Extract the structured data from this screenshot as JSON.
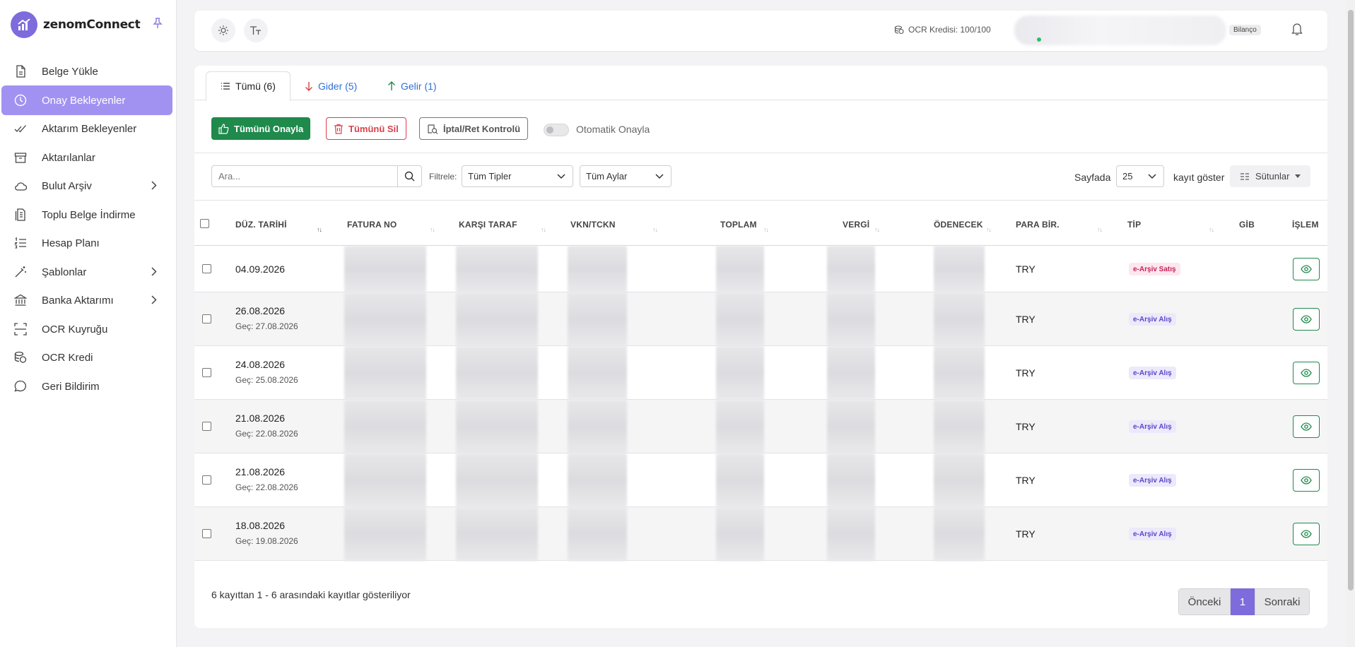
{
  "brand": {
    "name": "zenomConnect",
    "logo_color": "#7e6bdc"
  },
  "sidebar": {
    "items": [
      {
        "label": "Belge Yükle",
        "icon": "document-upload-icon",
        "active": false,
        "chevron": false
      },
      {
        "label": "Onay Bekleyenler",
        "icon": "clock-icon",
        "active": true,
        "chevron": false
      },
      {
        "label": "Aktarım Bekleyenler",
        "icon": "double-check-icon",
        "active": false,
        "chevron": false
      },
      {
        "label": "Aktarılanlar",
        "icon": "archive-box-icon",
        "active": false,
        "chevron": false
      },
      {
        "label": "Bulut Arşiv",
        "icon": "cloud-icon",
        "active": false,
        "chevron": true
      },
      {
        "label": "Toplu Belge İndirme",
        "icon": "files-icon",
        "active": false,
        "chevron": false
      },
      {
        "label": "Hesap Planı",
        "icon": "list-numbered-icon",
        "active": false,
        "chevron": false
      },
      {
        "label": "Şablonlar",
        "icon": "magic-wand-icon",
        "active": false,
        "chevron": true
      },
      {
        "label": "Banka Aktarımı",
        "icon": "bank-icon",
        "active": false,
        "chevron": true
      },
      {
        "label": "OCR Kuyruğu",
        "icon": "scan-icon",
        "active": false,
        "chevron": false
      },
      {
        "label": "OCR Kredi",
        "icon": "coins-icon",
        "active": false,
        "chevron": false
      },
      {
        "label": "Geri Bildirim",
        "icon": "chat-bubble-icon",
        "active": false,
        "chevron": false
      }
    ]
  },
  "topbar": {
    "ocr_credit": "OCR Kredisi: 100/100",
    "company_badge": "Bilanço"
  },
  "tabs": [
    {
      "label": "Tümü (6)",
      "active": true
    },
    {
      "label": "Gider (5)",
      "active": false
    },
    {
      "label": "Gelir (1)",
      "active": false
    }
  ],
  "actions": {
    "approve_all": "Tümünü Onayla",
    "delete_all": "Tümünü Sil",
    "cancel_check": "İptal/Ret Kontrolü",
    "auto_approve": "Otomatik Onayla",
    "auto_approve_on": false
  },
  "filters": {
    "search_placeholder": "Ara...",
    "filter_label": "Filtrele:",
    "type_select": "Tüm Tipler",
    "month_select": "Tüm Aylar",
    "per_page_prefix": "Sayfada",
    "per_page_value": "25",
    "per_page_suffix": "kayıt göster",
    "columns_button": "Sütunlar"
  },
  "table": {
    "headers": [
      "DÜZ. TARİHİ",
      "FATURA NO",
      "KARŞI TARAF",
      "VKN/TCKN",
      "TOPLAM",
      "VERGİ",
      "ÖDENECEK",
      "PARA BİR.",
      "TİP",
      "GİB",
      "İŞLEM"
    ],
    "rows": [
      {
        "date": "04.09.2026",
        "gec": "",
        "currency": "TRY",
        "type": "e-Arşiv Satış",
        "type_kind": "sat"
      },
      {
        "date": "26.08.2026",
        "gec": "Geç: 27.08.2026",
        "currency": "TRY",
        "type": "e-Arşiv Alış",
        "type_kind": "alis"
      },
      {
        "date": "24.08.2026",
        "gec": "Geç: 25.08.2026",
        "currency": "TRY",
        "type": "e-Arşiv Alış",
        "type_kind": "alis"
      },
      {
        "date": "21.08.2026",
        "gec": "Geç: 22.08.2026",
        "currency": "TRY",
        "type": "e-Arşiv Alış",
        "type_kind": "alis"
      },
      {
        "date": "21.08.2026",
        "gec": "Geç: 22.08.2026",
        "currency": "TRY",
        "type": "e-Arşiv Alış",
        "type_kind": "alis"
      },
      {
        "date": "18.08.2026",
        "gec": "Geç: 19.08.2026",
        "currency": "TRY",
        "type": "e-Arşiv Alış",
        "type_kind": "alis"
      }
    ]
  },
  "footer": {
    "info": "6 kayıttan 1 - 6 arasındaki kayıtlar gösteriliyor",
    "prev": "Önceki",
    "page": "1",
    "next": "Sonraki"
  },
  "colors": {
    "accent": "#7e6bdc",
    "active_nav": "#a192f2",
    "green": "#1f8a4c",
    "red": "#d9404a"
  }
}
